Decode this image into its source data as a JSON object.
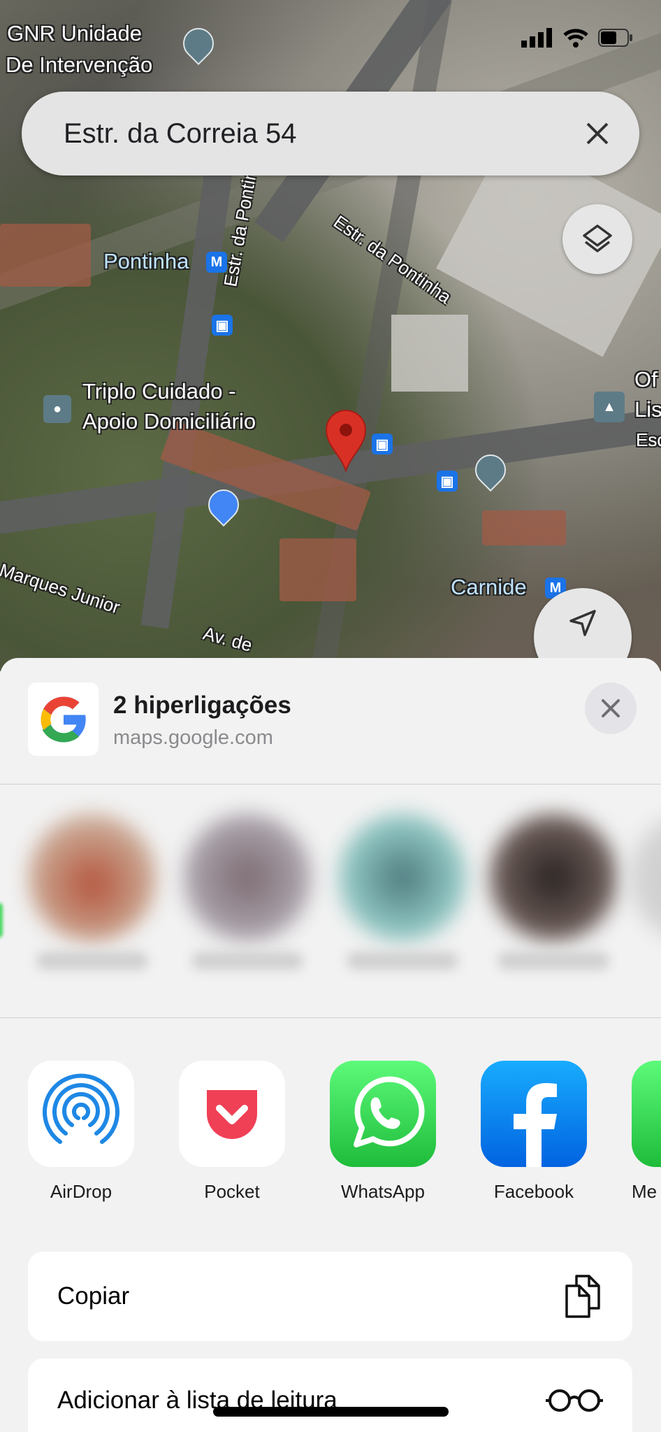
{
  "map": {
    "labels": {
      "gnr": "GNR Unidade",
      "gnr2": "De Intervenção",
      "pontinha": "Pontinha",
      "estr1": "Estr. da Pontinha",
      "estr2": "Estr. da Pontinha",
      "triplo": "Triplo Cuidado -",
      "triplo2": "Apoio Domiciliário",
      "carnide": "Carnide",
      "marques": "Marques Junior",
      "av": "Av. de",
      "of": "Of",
      "lis": "Lis",
      "esc": "Esc",
      "metro": "M",
      "bus": "🚌"
    },
    "pin_color": "#d93025"
  },
  "search": {
    "value": "Estr. da Correia 54"
  },
  "share": {
    "title": "2 hiperligações",
    "url": "maps.google.com",
    "apps": [
      {
        "label": "AirDrop"
      },
      {
        "label": "Pocket"
      },
      {
        "label": "WhatsApp"
      },
      {
        "label": "Facebook"
      },
      {
        "label": "Me"
      }
    ],
    "actions": [
      {
        "label": "Copiar",
        "icon": "copy-icon"
      },
      {
        "label": "Adicionar à lista de leitura",
        "icon": "glasses-icon"
      }
    ]
  }
}
